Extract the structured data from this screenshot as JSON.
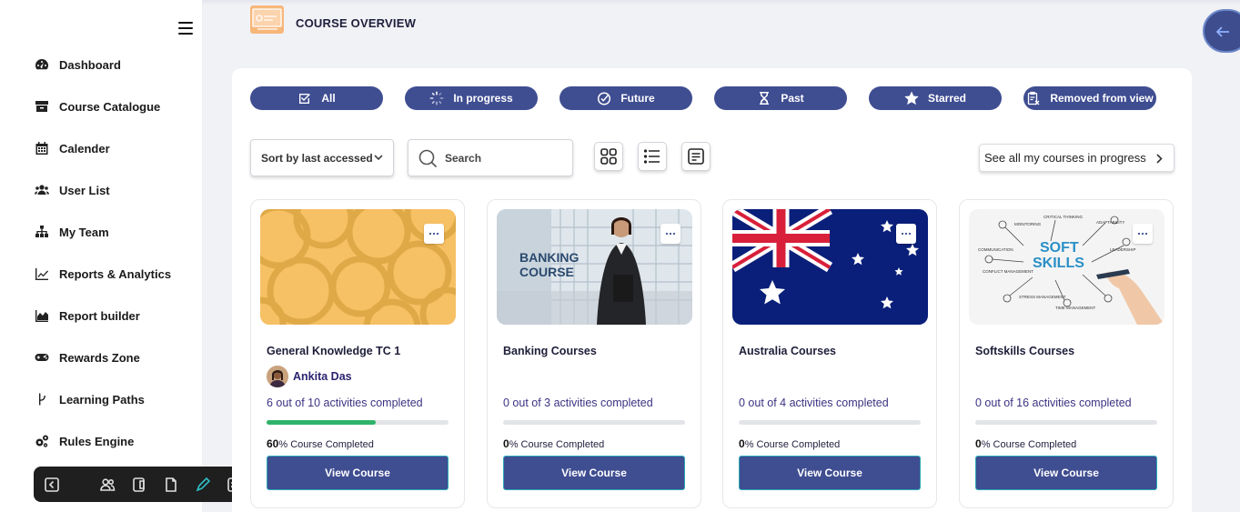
{
  "header": {
    "title": "COURSE OVERVIEW"
  },
  "sidebar": {
    "items": [
      {
        "label": "Dashboard",
        "icon": "dashboard-gauge-icon"
      },
      {
        "label": "Course Catalogue",
        "icon": "catalogue-box-icon"
      },
      {
        "label": "Calender",
        "icon": "calendar-icon"
      },
      {
        "label": "User List",
        "icon": "users-icon"
      },
      {
        "label": "My Team",
        "icon": "sitemap-icon"
      },
      {
        "label": "Reports & Analytics",
        "icon": "line-chart-icon"
      },
      {
        "label": "Report builder",
        "icon": "area-chart-icon"
      },
      {
        "label": "Rewards Zone",
        "icon": "gamepad-icon"
      },
      {
        "label": "Learning Paths",
        "icon": "branch-icon"
      },
      {
        "label": "Rules Engine",
        "icon": "cogs-icon"
      }
    ]
  },
  "filters": [
    {
      "label": "All",
      "icon": "check-square-icon"
    },
    {
      "label": "In progress",
      "icon": "spinner-icon"
    },
    {
      "label": "Future",
      "icon": "clock-check-icon"
    },
    {
      "label": "Past",
      "icon": "hourglass-icon"
    },
    {
      "label": "Starred",
      "icon": "star-icon"
    },
    {
      "label": "Removed from view",
      "icon": "clipboard-remove-icon"
    }
  ],
  "controls": {
    "sort_label": "Sort by last accessed",
    "search_placeholder": "Search",
    "see_all": "See all my courses in progress"
  },
  "cards": [
    {
      "title": "General Knowledge TC 1",
      "author": "Ankita Das",
      "progress_text": "6 out of 10 activities completed",
      "progress": 0.6,
      "percent": "60",
      "completed_suffix": "% Course Completed",
      "button": "View Course"
    },
    {
      "title": "Banking Courses",
      "author": "",
      "progress_text": "0 out of 3 activities completed",
      "progress": 0,
      "percent": "0",
      "completed_suffix": "% Course Completed",
      "button": "View Course",
      "image_text": [
        "BANKING",
        "COURSE"
      ]
    },
    {
      "title": "Australia Courses",
      "author": "",
      "progress_text": "0 out of 4 activities completed",
      "progress": 0,
      "percent": "0",
      "completed_suffix": "% Course Completed",
      "button": "View Course"
    },
    {
      "title": "Softskills Courses",
      "author": "",
      "progress_text": "0 out of 16 activities completed",
      "progress": 0,
      "percent": "0",
      "completed_suffix": "% Course Completed",
      "button": "View Course",
      "image_text": [
        "SOFT",
        "SKILLS"
      ]
    }
  ],
  "colors": {
    "primary": "#3f4d91",
    "progress": "#2fb36b",
    "accent_border": "#2aa9b7",
    "logo_bg": "#f7b77a"
  }
}
